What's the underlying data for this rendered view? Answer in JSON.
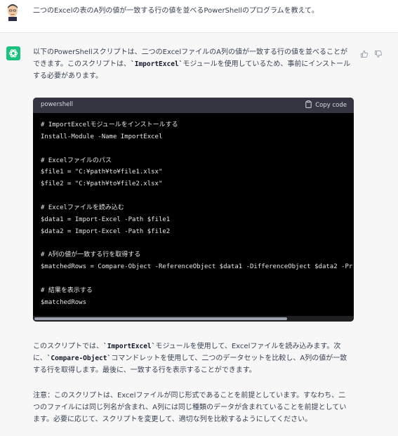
{
  "user_message": {
    "avatar": "user-face-avatar",
    "text": "二つのExcelの表のA列の値が一致する行の値を並べるPowerShellのプログラムを教えて。"
  },
  "assistant": {
    "avatar": "chatgpt-logo-icon",
    "feedback": {
      "thumbs_up": "thumbs-up-icon",
      "thumbs_down": "thumbs-down-icon"
    },
    "intro": {
      "before": "以下のPowerShellスクリプトは、二つのExcelファイルのA列の値が一致する行の値を並べることができます。このスクリプトは、",
      "code": "`ImportExcel`",
      "after": "モジュールを使用しているため、事前にインストールする必要があります。"
    },
    "code_block": {
      "language": "powershell",
      "copy_label": "Copy code",
      "lines": [
        "# ImportExcelモジュールをインストールする",
        "Install-Module -Name ImportExcel",
        "",
        "# Excelファイルのパス",
        "$file1 = \"C:¥path¥to¥file1.xlsx\"",
        "$file2 = \"C:¥path¥to¥file2.xlsx\"",
        "",
        "# Excelファイルを読み込む",
        "$data1 = Import-Excel -Path $file1",
        "$data2 = Import-Excel -Path $file2",
        "",
        "# A列の値が一致する行を取得する",
        "$matchedRows = Compare-Object -ReferenceObject $data1 -DifferenceObject $data2 -Pr",
        "",
        "# 結果を表示する",
        "$matchedRows"
      ]
    },
    "explanation": {
      "before": "このスクリプトでは、",
      "code1": "`ImportExcel`",
      "middle": "モジュールを使用して、Excelファイルを読み込みます。次に、",
      "code2": "`Compare-Object`",
      "after": "コマンドレットを使用して、二つのデータセットを比較し、A列の値が一致する行を取得します。最後に、一致する行を表示することができます。"
    },
    "note": "注意：このスクリプトは、Excelファイルが同じ形式であることを前提としています。すなわち、二つのファイルには同じ列名が含まれ、A列には同じ種類のデータが含まれていることを前提としています。必要に応じて、スクリプトを変更して、適切な列を比較するようにしてください。"
  },
  "colors": {
    "code_background": "#000000",
    "code_header": "#343541",
    "assistant_background": "#f7f7f8",
    "brand": "#19c37d"
  }
}
